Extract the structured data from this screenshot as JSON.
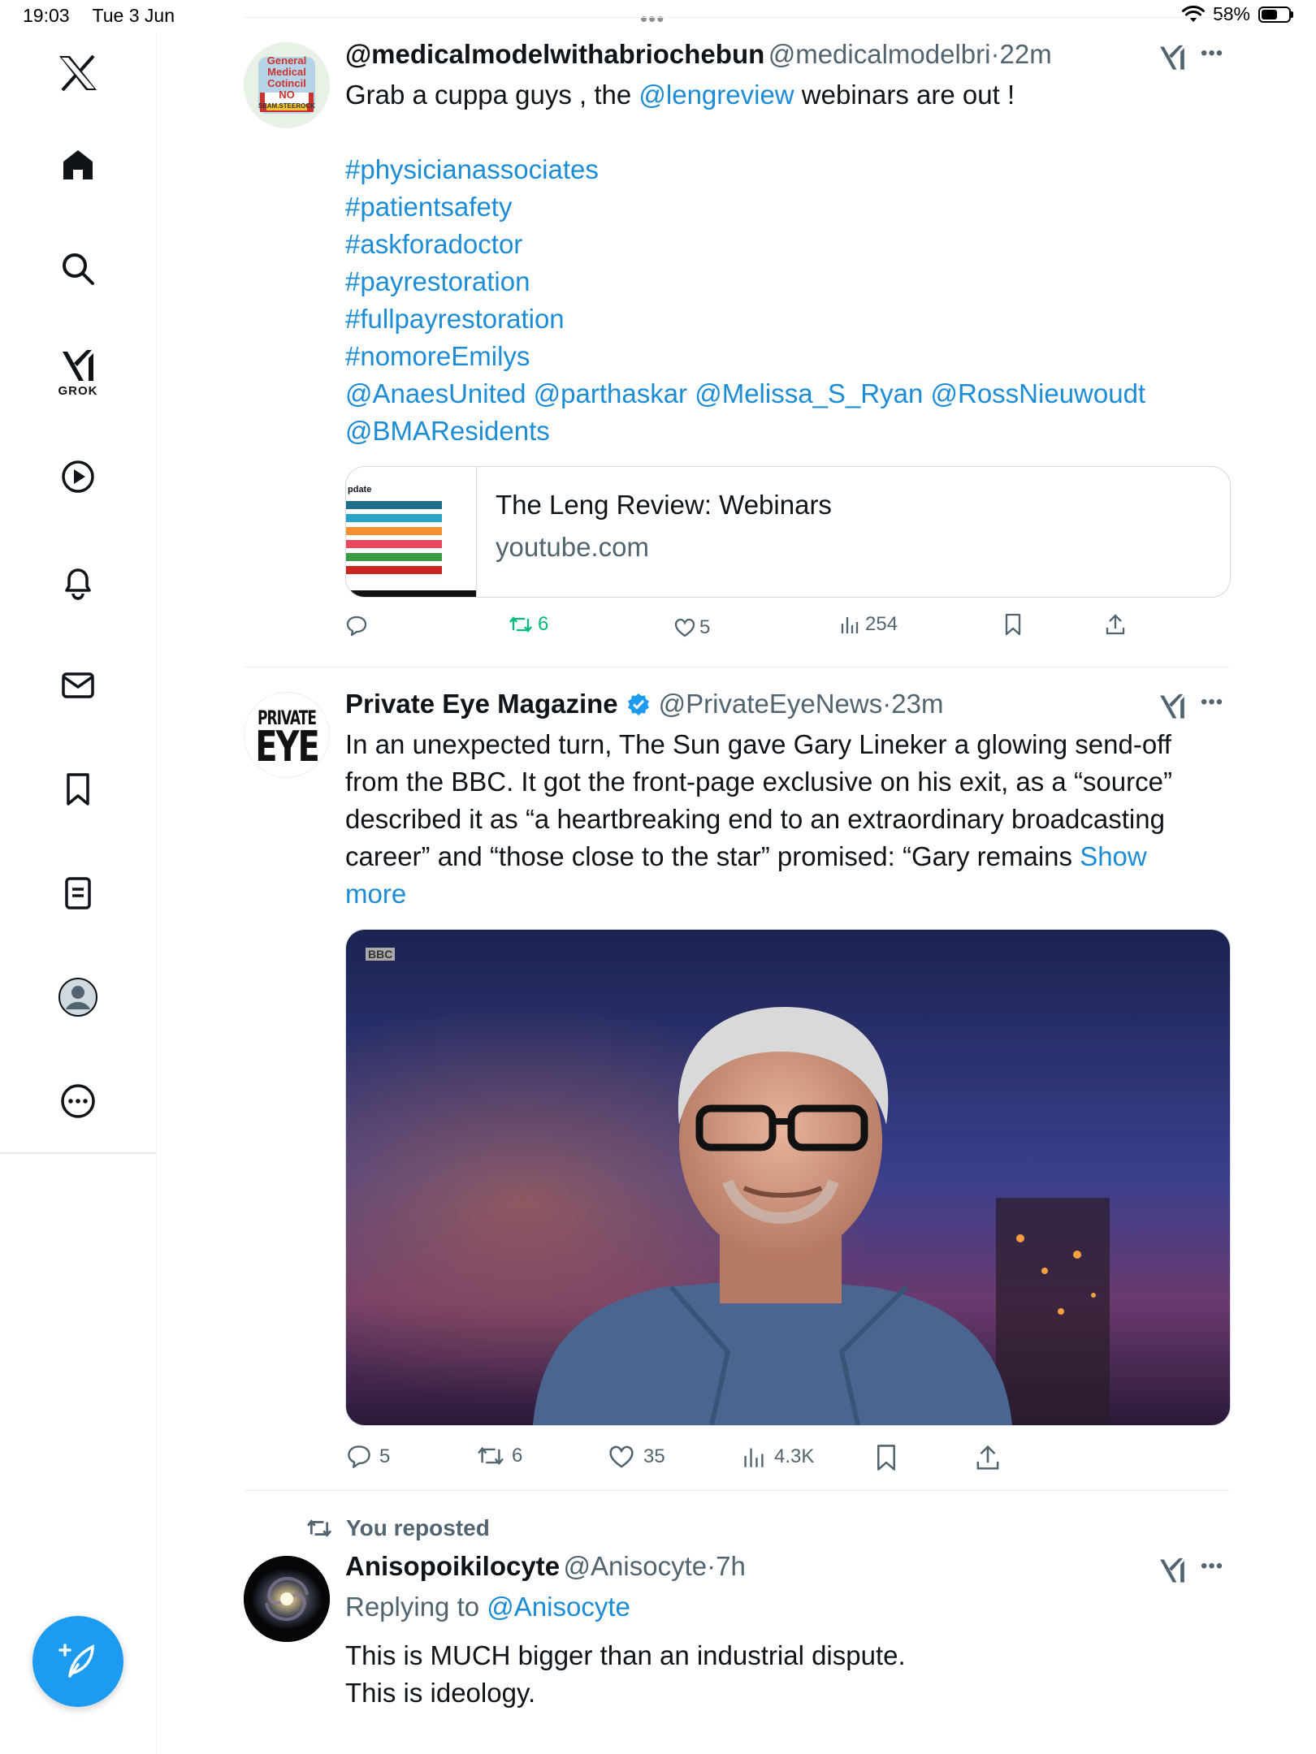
{
  "status_bar": {
    "time": "19:03",
    "date": "Tue 3 Jun",
    "battery": "58%",
    "battery_level": 0.58
  },
  "sidebar": {
    "logo": "x-logo-icon",
    "items": [
      {
        "name": "home",
        "icon": "home-icon"
      },
      {
        "name": "search",
        "icon": "search-icon"
      },
      {
        "name": "grok",
        "icon": "grok-icon",
        "label": "GROK"
      },
      {
        "name": "video",
        "icon": "play-icon"
      },
      {
        "name": "notifications",
        "icon": "bell-icon"
      },
      {
        "name": "messages",
        "icon": "mail-icon"
      },
      {
        "name": "bookmarks",
        "icon": "bookmark-icon"
      },
      {
        "name": "lists",
        "icon": "list-icon"
      },
      {
        "name": "profile",
        "icon": "avatar-icon"
      },
      {
        "name": "more",
        "icon": "more-icon"
      }
    ],
    "compose_icon": "compose-icon"
  },
  "tweets": [
    {
      "name": "@medicalmodelwithabriochebun",
      "handle": "@medicalmodelbri",
      "sep": "·",
      "time": "22m",
      "avatar_text": [
        "General",
        "Medical",
        "Cotincil",
        "NO",
        "SEAM.STEEROCK"
      ],
      "text_pre": "Grab a cuppa guys , the ",
      "mention": "@lengreview",
      "text_post": " webinars are out !",
      "hashtags": [
        "#physicianassociates",
        "#patientsafety",
        "#askforadoctor",
        "#payrestoration",
        "#fullpayrestoration",
        "#nomoreEmilys"
      ],
      "mentions_line1": "@AnaesUnited @parthaskar @Melissa_S_Ryan @RossNieuwoudt",
      "mentions_line2": "@BMAResidents",
      "card": {
        "title": "The Leng Review: Webinars",
        "domain": "youtube.com",
        "thumb_heading": "pdate"
      },
      "replies": "",
      "retweets": "6",
      "likes": "5",
      "views": "254"
    },
    {
      "name": "Private Eye Magazine",
      "verified": true,
      "handle": "@PrivateEyeNews",
      "sep": "·",
      "time": "23m",
      "avatar_text": [
        "PRIVATE",
        "EYE"
      ],
      "lines": [
        "In an unexpected turn, The Sun gave Gary Lineker a glowing send-off",
        "from the BBC. It got the front-page exclusive on his exit, as a “source”",
        "described it as “a heartbreaking end to an extraordinary broadcasting",
        "career” and “those close to the star” promised: “Gary remains "
      ],
      "show": "Show",
      "more": "more",
      "media_watermark": "BBC",
      "replies": "5",
      "retweets": "6",
      "likes": "35",
      "views": "4.3K"
    },
    {
      "reposted_label": "You reposted",
      "name": "Anisopoikilocyte",
      "handle": "@Anisocyte",
      "sep": "·",
      "time": "7h",
      "replying_pre": "Replying to ",
      "replying_to": "@Anisocyte",
      "line1": "This is MUCH bigger than an industrial dispute.",
      "line2": "This is ideology."
    }
  ],
  "colors": {
    "link": "#1d8cd6",
    "retweet_green": "#00ba7c",
    "compose_blue": "#1d9bf0",
    "verified": "#1d9bf0"
  }
}
